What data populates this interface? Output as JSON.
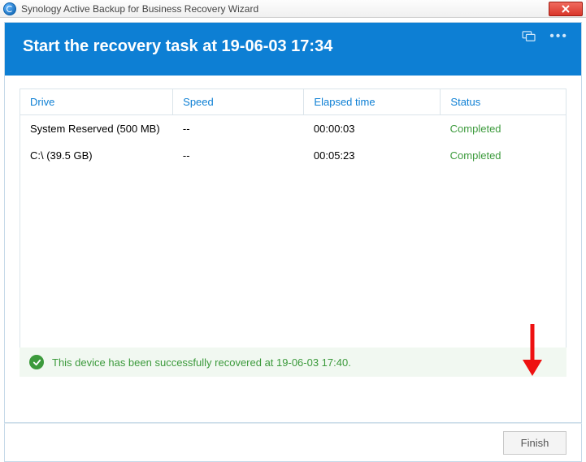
{
  "window": {
    "title": "Synology Active Backup for Business Recovery Wizard"
  },
  "header": {
    "heading": "Start the recovery task at 19-06-03 17:34"
  },
  "colors": {
    "accent": "#0d7fd4",
    "success": "#3c9a3c"
  },
  "table": {
    "headers": {
      "drive": "Drive",
      "speed": "Speed",
      "elapsed": "Elapsed time",
      "status": "Status"
    },
    "rows": [
      {
        "drive": "System Reserved (500 MB)",
        "speed": "--",
        "elapsed": "00:00:03",
        "status": "Completed"
      },
      {
        "drive": "C:\\ (39.5 GB)",
        "speed": "--",
        "elapsed": "00:05:23",
        "status": "Completed"
      }
    ]
  },
  "status": {
    "message": "This device has been successfully recovered at 19-06-03 17:40."
  },
  "footer": {
    "finish_label": "Finish"
  }
}
